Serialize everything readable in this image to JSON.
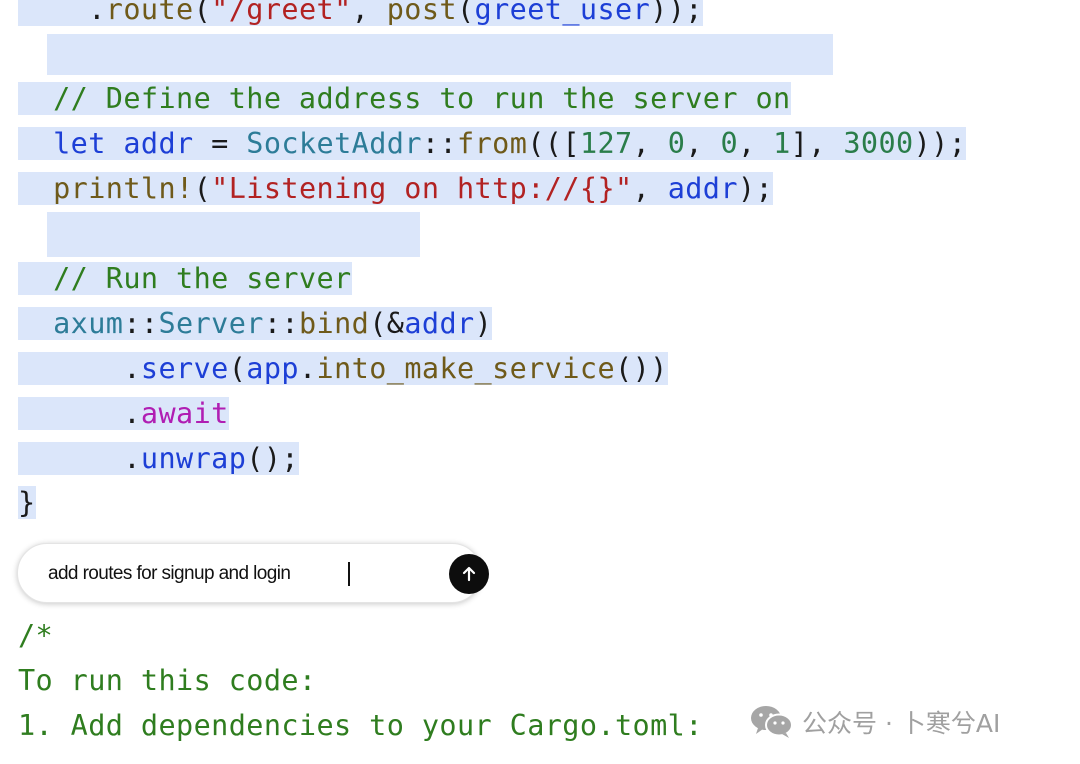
{
  "code": {
    "line_route": [
      {
        "t": "    .",
        "c": "pl"
      },
      {
        "t": "route",
        "c": "fn"
      },
      {
        "t": "(",
        "c": "pl"
      },
      {
        "t": "\"/greet\"",
        "c": "str"
      },
      {
        "t": ", ",
        "c": "pl"
      },
      {
        "t": "post",
        "c": "fn"
      },
      {
        "t": "(",
        "c": "pl"
      },
      {
        "t": "greet_user",
        "c": "var"
      },
      {
        "t": "));",
        "c": "pl"
      }
    ],
    "line_comment_addr": [
      {
        "t": "  // Define the address to run the server on",
        "c": "cm"
      }
    ],
    "line_let_addr": [
      {
        "t": "  ",
        "c": "pl"
      },
      {
        "t": "let",
        "c": "kw"
      },
      {
        "t": " ",
        "c": "pl"
      },
      {
        "t": "addr",
        "c": "var"
      },
      {
        "t": " = ",
        "c": "pl"
      },
      {
        "t": "SocketAddr",
        "c": "ty"
      },
      {
        "t": "::",
        "c": "pl"
      },
      {
        "t": "from",
        "c": "fn"
      },
      {
        "t": "(([",
        "c": "pl"
      },
      {
        "t": "127",
        "c": "num"
      },
      {
        "t": ", ",
        "c": "pl"
      },
      {
        "t": "0",
        "c": "num"
      },
      {
        "t": ", ",
        "c": "pl"
      },
      {
        "t": "0",
        "c": "num"
      },
      {
        "t": ", ",
        "c": "pl"
      },
      {
        "t": "1",
        "c": "num"
      },
      {
        "t": "], ",
        "c": "pl"
      },
      {
        "t": "3000",
        "c": "num"
      },
      {
        "t": "));",
        "c": "pl"
      }
    ],
    "line_println": [
      {
        "t": "  ",
        "c": "pl"
      },
      {
        "t": "println!",
        "c": "fn"
      },
      {
        "t": "(",
        "c": "pl"
      },
      {
        "t": "\"Listening on http://{}\"",
        "c": "str"
      },
      {
        "t": ", ",
        "c": "pl"
      },
      {
        "t": "addr",
        "c": "var"
      },
      {
        "t": ");",
        "c": "pl"
      }
    ],
    "line_comment_run": [
      {
        "t": "  // Run the server",
        "c": "cm"
      }
    ],
    "line_axum": [
      {
        "t": "  ",
        "c": "pl"
      },
      {
        "t": "axum",
        "c": "ty"
      },
      {
        "t": "::",
        "c": "pl"
      },
      {
        "t": "Server",
        "c": "ty"
      },
      {
        "t": "::",
        "c": "pl"
      },
      {
        "t": "bind",
        "c": "fn"
      },
      {
        "t": "(&",
        "c": "pl"
      },
      {
        "t": "addr",
        "c": "var"
      },
      {
        "t": ")",
        "c": "pl"
      }
    ],
    "line_serve": [
      {
        "t": "      .",
        "c": "pl"
      },
      {
        "t": "serve",
        "c": "kw"
      },
      {
        "t": "(",
        "c": "pl"
      },
      {
        "t": "app",
        "c": "kw"
      },
      {
        "t": ".",
        "c": "pl"
      },
      {
        "t": "into_make_service",
        "c": "fn"
      },
      {
        "t": "())",
        "c": "pl"
      }
    ],
    "line_await": [
      {
        "t": "      .",
        "c": "pl"
      },
      {
        "t": "await",
        "c": "aw"
      }
    ],
    "line_unwrap": [
      {
        "t": "      .",
        "c": "pl"
      },
      {
        "t": "unwrap",
        "c": "kw"
      },
      {
        "t": "();",
        "c": "pl"
      }
    ],
    "line_close": [
      {
        "t": "}",
        "c": "pl"
      }
    ]
  },
  "prompt": {
    "value": "add routes for signup and login",
    "send_icon": "arrow-up-icon"
  },
  "comments": {
    "line1": "/*",
    "line2": "To run this code:",
    "line3": "1. Add dependencies to your Cargo.toml:"
  },
  "watermark": {
    "text": "公众号 · 卜寒兮AI",
    "icon": "wechat-icon"
  },
  "colors": {
    "selection": "#dbe6fa",
    "keyword": "#1d3fd6",
    "type": "#2d7c98",
    "function": "#6f5a1a",
    "string": "#b22222",
    "number": "#2a7d4a",
    "comment": "#2f7d1f",
    "await": "#b01eb3",
    "send_button": "#0d0d0d"
  }
}
